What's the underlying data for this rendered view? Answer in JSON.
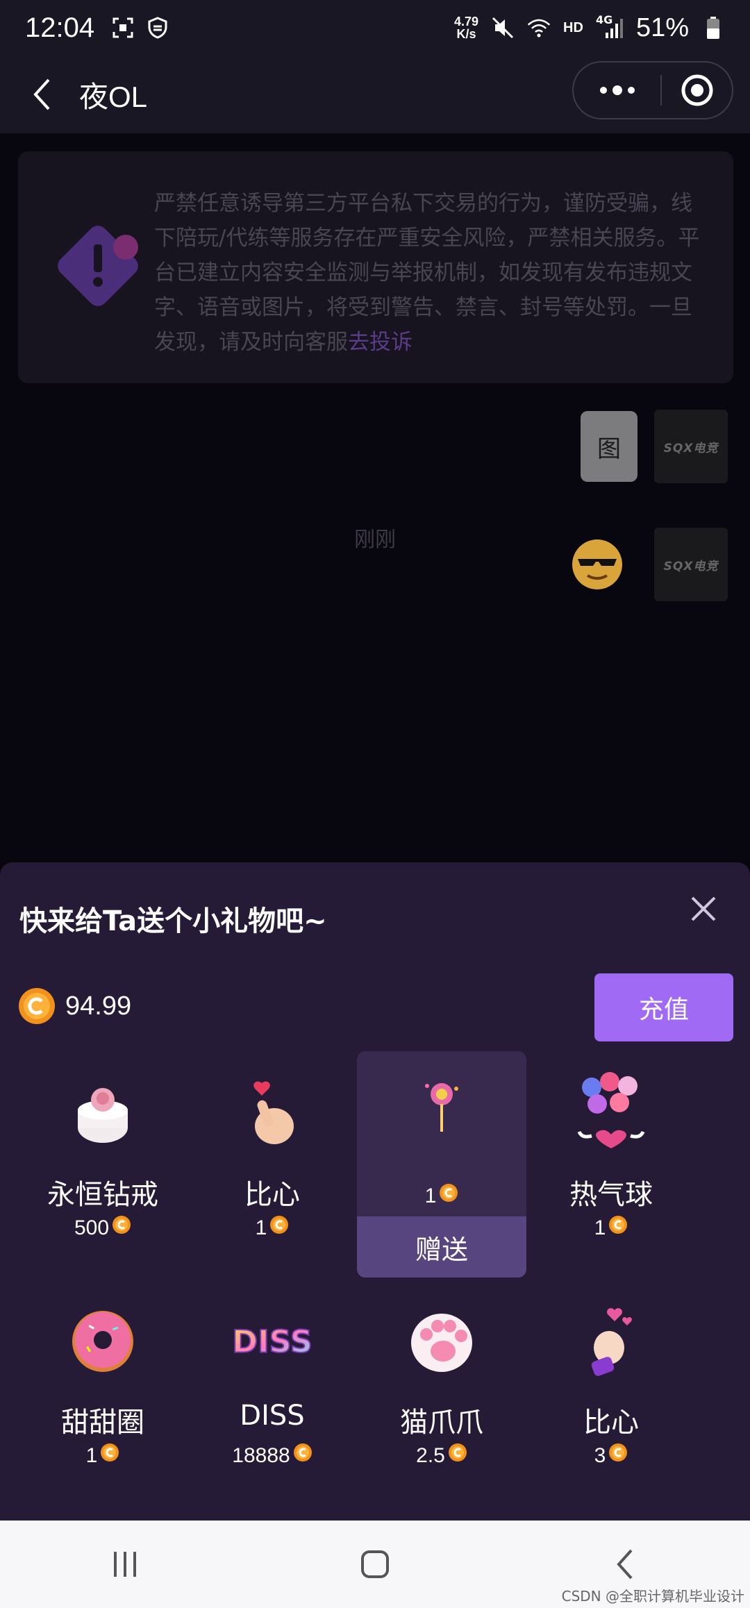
{
  "status_bar": {
    "time": "12:04",
    "net_speed_value": "4.79",
    "net_speed_unit": "K/s",
    "hd_label": "HD",
    "network_type": "4G",
    "battery_percent": "51%"
  },
  "header": {
    "title": "夜OL"
  },
  "chat": {
    "notice_text": "严禁任意诱导第三方平台私下交易的行为，谨防受骗，线下陪玩/代练等服务存在严重安全风险，严禁相关服务。平台已建立内容安全监测与举报机制，如发现有发布违规文字、语音或图片，将受到警告、禁言、封号等处罚。一旦发现，请及时向客服",
    "notice_link": "去投诉",
    "image_placeholder_label": "图",
    "avatar_text": "SQX电竞",
    "timestamp": "刚刚"
  },
  "gift_panel": {
    "title": "快来给Ta送个小礼物吧~",
    "balance": "94.99",
    "recharge_label": "充值",
    "send_label": "赠送",
    "gifts": [
      {
        "name": "永恒钻戒",
        "price": "500",
        "icon": "rose-cake-icon"
      },
      {
        "name": "比心",
        "price": "1",
        "icon": "finger-heart-icon"
      },
      {
        "name": "",
        "price": "1",
        "icon": "lollipop-icon",
        "selected": true
      },
      {
        "name": "热气球",
        "price": "1",
        "icon": "balloons-icon"
      },
      {
        "name": "甜甜圈",
        "price": "1",
        "icon": "donut-icon"
      },
      {
        "name": "DISS",
        "price": "18888",
        "icon": "diss-icon"
      },
      {
        "name": "猫爪爪",
        "price": "2.5",
        "icon": "cat-paw-icon"
      },
      {
        "name": "比心",
        "price": "3",
        "icon": "hand-heart-icon"
      }
    ]
  },
  "watermark": "CSDN @全职计算机毕业设计",
  "colors": {
    "accent": "#a16af5",
    "panel_bg": "#251b36",
    "header_bg": "#1a1724"
  }
}
